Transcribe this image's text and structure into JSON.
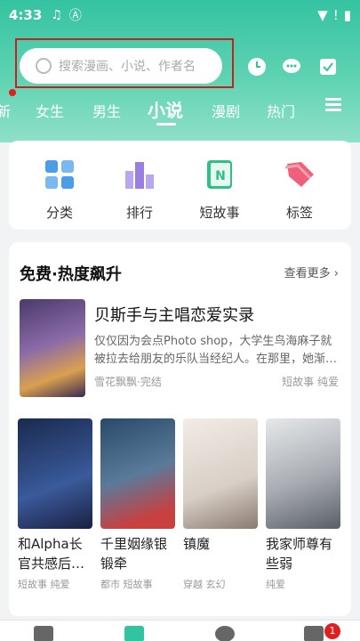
{
  "status_bar": {
    "time": "4:33",
    "icons": [
      "music-icon",
      "a-icon",
      "wifi-icon",
      "alert-icon",
      "battery-icon"
    ]
  },
  "search": {
    "placeholder": "搜索漫画、小说、作者名"
  },
  "tabs": [
    "新",
    "女生",
    "男生",
    "小说",
    "漫剧",
    "热门"
  ],
  "active_tab": "小说",
  "categories": [
    {
      "label": "分类",
      "icon": "grid-icon",
      "color": "#4a9ee8"
    },
    {
      "label": "排行",
      "icon": "bar-chart-icon",
      "color": "#9a7ee0"
    },
    {
      "label": "短故事",
      "icon": "n-book-icon",
      "color": "#2ec08a"
    },
    {
      "label": "标签",
      "icon": "tag-icon",
      "color": "#f0607a"
    }
  ],
  "free_section": {
    "title": "免费·热度飙升",
    "see_more": "查看更多 ›",
    "featured": {
      "title": "贝斯手与主唱恋爱实录",
      "desc": "仅仅因为会点Photo shop，大学生鸟海麻子就被拉去给朋友的乐队当经纪人。在那里，她渐…",
      "meta": "雪花飘飘·完结",
      "tags": "短故事  纯爱"
    },
    "books": [
      {
        "title": "和Alpha长官共感后…",
        "tags": "短故事  纯爱",
        "color": "#2a3f6a"
      },
      {
        "title": "千里姻缘银锻牵",
        "tags": "都市  短故事",
        "color": "#3a5a7a"
      },
      {
        "title": "镇魔",
        "tags": "穿越  玄幻",
        "color": "#e8e0d8"
      },
      {
        "title": "我家师尊有些弱",
        "tags": "纯爱",
        "color": "#c8ccd0"
      }
    ]
  },
  "bottom_nav": {
    "badge": "1"
  },
  "colors": {
    "accent": "#34c3a1",
    "highlight": "#c82020"
  }
}
